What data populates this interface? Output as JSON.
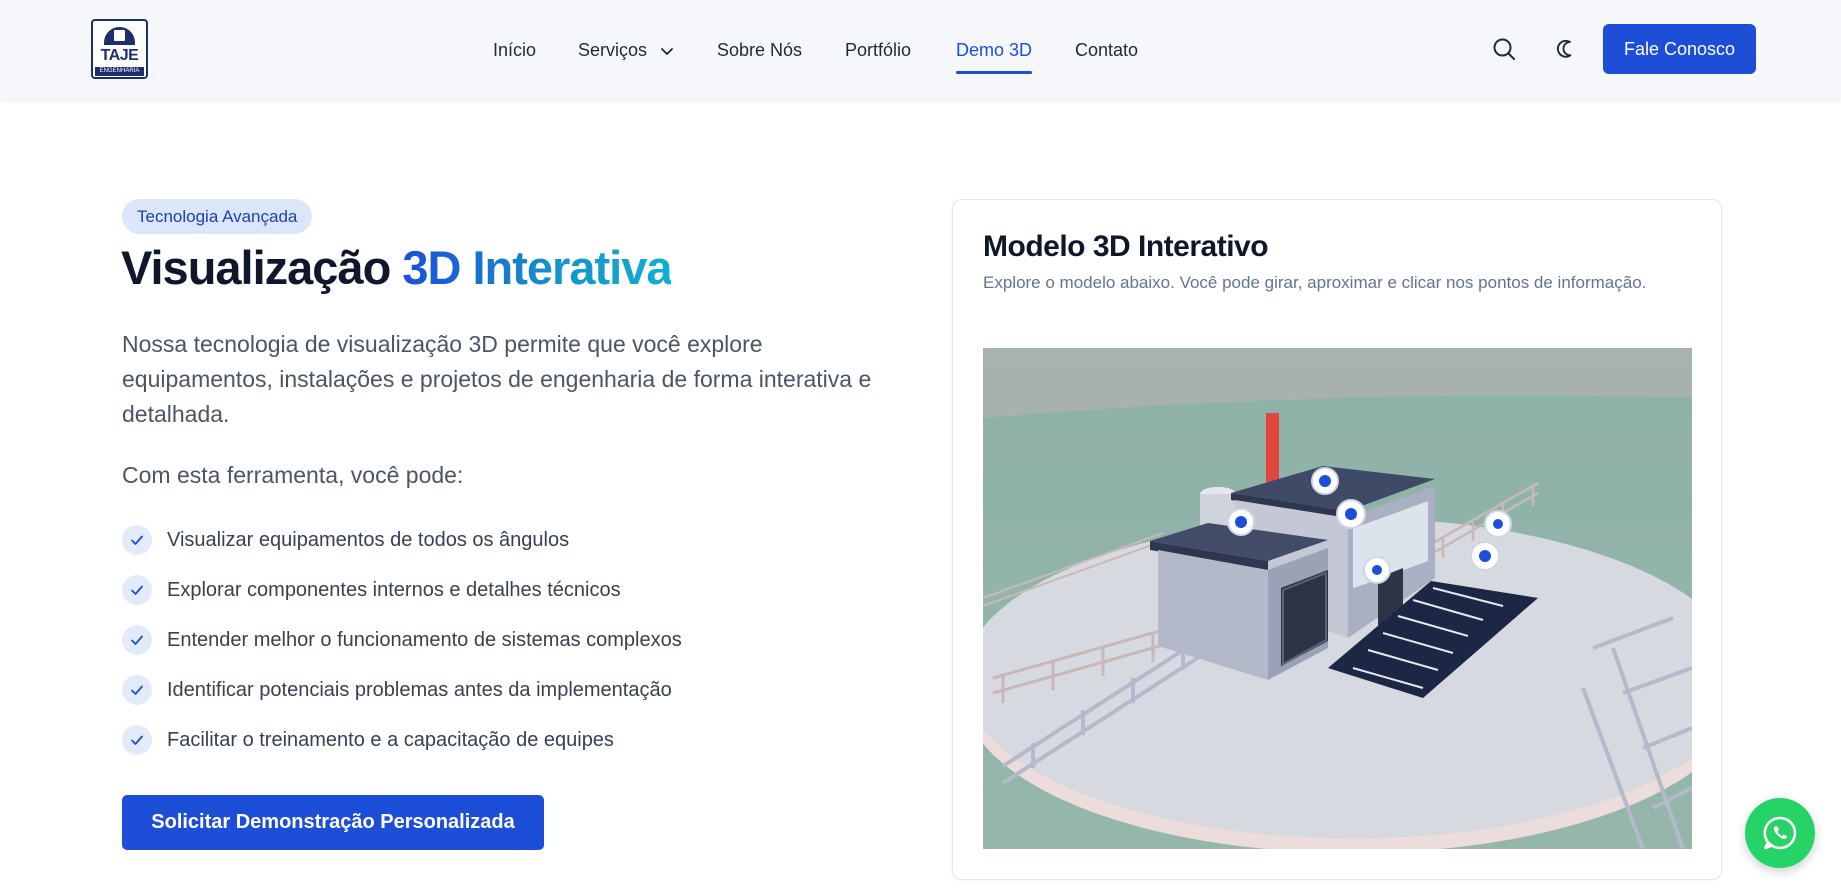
{
  "header": {
    "logo": {
      "title": "TAJE",
      "subtitle": "ENGENHARIA",
      "icon": "building-arch-logo"
    },
    "nav": [
      {
        "label": "Início",
        "active": false
      },
      {
        "label": "Serviços",
        "active": false,
        "has_dropdown": true,
        "icon": "chevron-down-icon"
      },
      {
        "label": "Sobre Nós",
        "active": false
      },
      {
        "label": "Portfólio",
        "active": false
      },
      {
        "label": "Demo 3D",
        "active": true
      },
      {
        "label": "Contato",
        "active": false
      }
    ],
    "icons": {
      "search": "search-icon",
      "theme": "moon-icon"
    },
    "cta_label": "Fale Conosco"
  },
  "hero": {
    "badge": "Tecnologia Avançada",
    "title_plain": "Visualização ",
    "title_highlight": "3D Interativa",
    "description": "Nossa tecnologia de visualização 3D permite que você explore equipamentos, instalações e projetos de engenharia de forma interativa e detalhada.",
    "lead": "Com esta ferramenta, você pode:",
    "features": [
      "Visualizar equipamentos de todos os ângulos",
      "Explorar componentes internos e detalhes técnicos",
      "Entender melhor o funcionamento de sistemas complexos",
      "Identificar potenciais problemas antes da implementação",
      "Facilitar o treinamento e a capacitação de equipes"
    ],
    "button_label": "Solicitar Demonstração Personalizada"
  },
  "model_card": {
    "title": "Modelo 3D Interativo",
    "subtitle": "Explore o modelo abaixo. Você pode girar, aproximar e clicar nos pontos de informação.",
    "hotspot_count": 6
  },
  "whatsapp": {
    "icon": "whatsapp-icon"
  },
  "colors": {
    "primary": "#1d4ed8",
    "header_bg": "#f5f7fb",
    "badge_bg": "#dbe6fb",
    "whatsapp": "#25d366",
    "scene_bg": "#94b4ac"
  }
}
